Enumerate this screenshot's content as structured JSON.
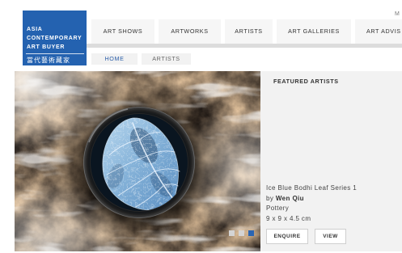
{
  "header": {
    "logo": {
      "lines": [
        "ASIA",
        "CONTEMPORARY",
        "ART BUYER"
      ],
      "chinese_name": "當代藝術藏家"
    },
    "top_right_link": "M",
    "nav": [
      {
        "label": "ART SHOWS"
      },
      {
        "label": "ARTWORKS"
      },
      {
        "label": "ARTISTS"
      },
      {
        "label": "ART GALLERIES"
      },
      {
        "label": "ART ADVIS"
      }
    ]
  },
  "breadcrumb": [
    {
      "label": "HOME"
    },
    {
      "label": "ARTISTS"
    }
  ],
  "slideshow": {
    "dots": [
      {
        "active": false
      },
      {
        "active": false
      },
      {
        "active": true
      }
    ]
  },
  "featured": {
    "heading": "FEATURED ARTISTS",
    "artwork": {
      "title": "Ice Blue Bodhi Leaf Series 1",
      "by_prefix": "by",
      "artist": "Wen Qiu",
      "medium": "Pottery",
      "dimensions": "9 x 9 x 4.5 cm"
    },
    "enquire_label": "ENQUIRE",
    "view_label": "VIEW"
  },
  "colors": {
    "brand_blue": "#2462b0",
    "breadcrumb_link": "#2c5ea8",
    "active_dot": "#2b65b2",
    "inactive_dot": "#d4d4d4",
    "panel_bg": "#f2f2f2"
  }
}
